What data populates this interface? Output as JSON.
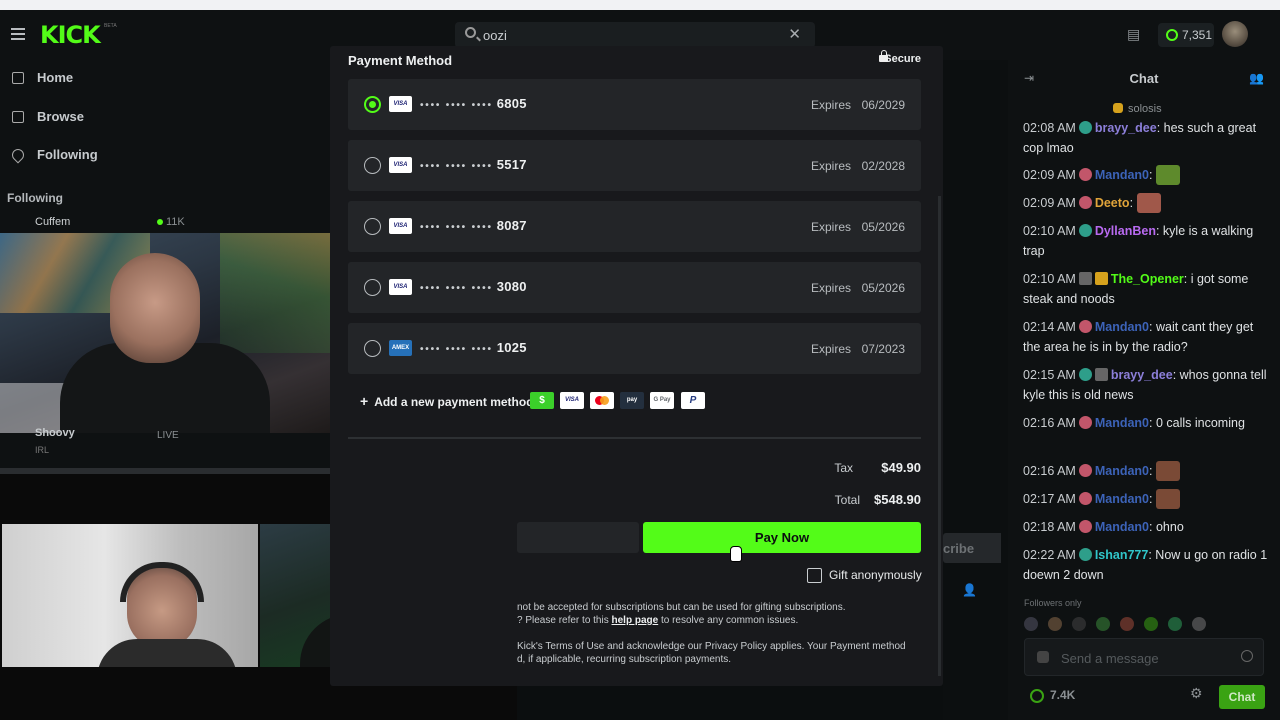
{
  "header": {
    "logo": "KICK",
    "logo_badge": "BETA",
    "search_value": "oozi",
    "points": "7,351"
  },
  "sidebar": {
    "nav": [
      {
        "label": "Home",
        "icon": "home-icon"
      },
      {
        "label": "Browse",
        "icon": "browse-icon"
      },
      {
        "label": "Following",
        "icon": "heart-icon"
      }
    ],
    "following_header": "Following",
    "streams": [
      {
        "name": "Cuffem",
        "viewers": "11K"
      },
      {
        "name": "Shoovy",
        "category": "IRL",
        "status": "LIVE"
      }
    ]
  },
  "modal": {
    "title": "Payment Method",
    "secure_label": "Secure",
    "cards": [
      {
        "brand": "VISA",
        "dots": "•••• •••• ••••",
        "last4": "6805",
        "expires_label": "Expires",
        "expires": "06/2029",
        "selected": true
      },
      {
        "brand": "VISA",
        "dots": "•••• •••• ••••",
        "last4": "5517",
        "expires_label": "Expires",
        "expires": "02/2028",
        "selected": false
      },
      {
        "brand": "VISA",
        "dots": "•••• •••• ••••",
        "last4": "8087",
        "expires_label": "Expires",
        "expires": "05/2026",
        "selected": false
      },
      {
        "brand": "VISA",
        "dots": "•••• •••• ••••",
        "last4": "3080",
        "expires_label": "Expires",
        "expires": "05/2026",
        "selected": false
      },
      {
        "brand": "AMEX",
        "dots": "•••• •••• ••••",
        "last4": "1025",
        "expires_label": "Expires",
        "expires": "07/2023",
        "selected": false
      }
    ],
    "add_method_label": "Add a new payment method",
    "methods": [
      "$",
      "VISA",
      "MC",
      "pay",
      "G Pay",
      "P"
    ],
    "tax_label": "Tax",
    "tax_value": "$49.90",
    "total_label": "Total",
    "total_value": "$548.90",
    "pay_button": "Pay Now",
    "gift_label": "Gift anonymously",
    "note_1": "not be accepted for subscriptions but can be used for gifting subscriptions.",
    "note_2_prefix": "? Please refer to this",
    "note_2_link": "help page",
    "note_2_suffix": "to resolve any common issues.",
    "note_3": "Kick's Terms of Use and acknowledge our Privacy Policy applies. Your Payment method",
    "note_4": "d, if applicable, recurring subscription payments."
  },
  "subscribe_ghost": "cribe",
  "chat": {
    "title": "Chat",
    "pinned_user": "solosis",
    "messages": [
      {
        "time": "02:08 AM",
        "user": "brayy_dee",
        "color": "#8c7fd9",
        "text": "hes such a great cop lmao"
      },
      {
        "time": "02:09 AM",
        "user": "Mandan0",
        "color": "#3c63b8",
        "text": ""
      },
      {
        "time": "02:09 AM",
        "user": "Deeto",
        "color": "#e0a43a",
        "text": ""
      },
      {
        "time": "02:10 AM",
        "user": "DyllanBen",
        "color": "#b86af0",
        "text": "kyle is a walking trap"
      },
      {
        "time": "02:10 AM",
        "user": "The_Opener",
        "color": "#53fc18",
        "text": "i got some steak and noods"
      },
      {
        "time": "02:14 AM",
        "user": "Mandan0",
        "color": "#3c63b8",
        "text": "wait cant they get the area he is in by the radio?"
      },
      {
        "time": "02:15 AM",
        "user": "brayy_dee",
        "color": "#8c7fd9",
        "text": "whos gonna tell kyle this is old news"
      },
      {
        "time": "02:16 AM",
        "user": "Mandan0",
        "color": "#3c63b8",
        "text": "0 calls incoming"
      },
      {
        "time": "02:16 AM",
        "user": "Mandan0",
        "color": "#3c63b8",
        "text": ""
      },
      {
        "time": "02:17 AM",
        "user": "Mandan0",
        "color": "#3c63b8",
        "text": ""
      },
      {
        "time": "02:18 AM",
        "user": "Mandan0",
        "color": "#3c63b8",
        "text": "ohno"
      },
      {
        "time": "02:22 AM",
        "user": "Ishan777",
        "color": "#30c6c9",
        "text": "Now u go on radio 1 doewn 2 down"
      }
    ],
    "followers_only": "Followers only",
    "input_placeholder": "Send a message",
    "points": "7.4K",
    "send_button": "Chat"
  },
  "colors": {
    "accent": "#53fc18",
    "modal_bg": "#18191c",
    "row_bg": "#232528"
  }
}
